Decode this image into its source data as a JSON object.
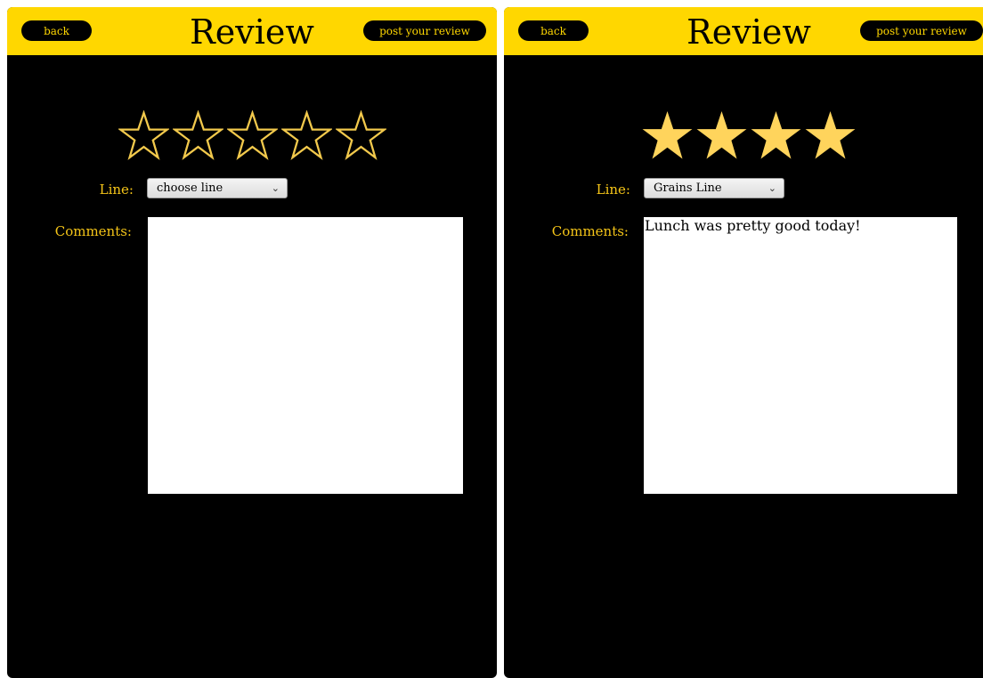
{
  "screens": [
    {
      "back_label": "back",
      "title": "Review",
      "post_label": "post your review",
      "rating": {
        "value": 0,
        "max": 5
      },
      "line_label": "Line:",
      "line_value": "choose line",
      "comments_label": "Comments:",
      "comments_value": ""
    },
    {
      "back_label": "back",
      "title": "Review",
      "post_label": "post your review",
      "rating": {
        "value": 4,
        "max": 4
      },
      "line_label": "Line:",
      "line_value": "Grains Line",
      "comments_label": "Comments:",
      "comments_value": "Lunch was pretty good today!"
    }
  ],
  "icons": {
    "star": "star-icon",
    "dropdown": "chevron-down-icon"
  },
  "colors": {
    "header": "#ffd700",
    "background": "#000000",
    "label": "#f5c518",
    "star_outline": "#f2c94c",
    "star_fill": "#ffd45c"
  }
}
